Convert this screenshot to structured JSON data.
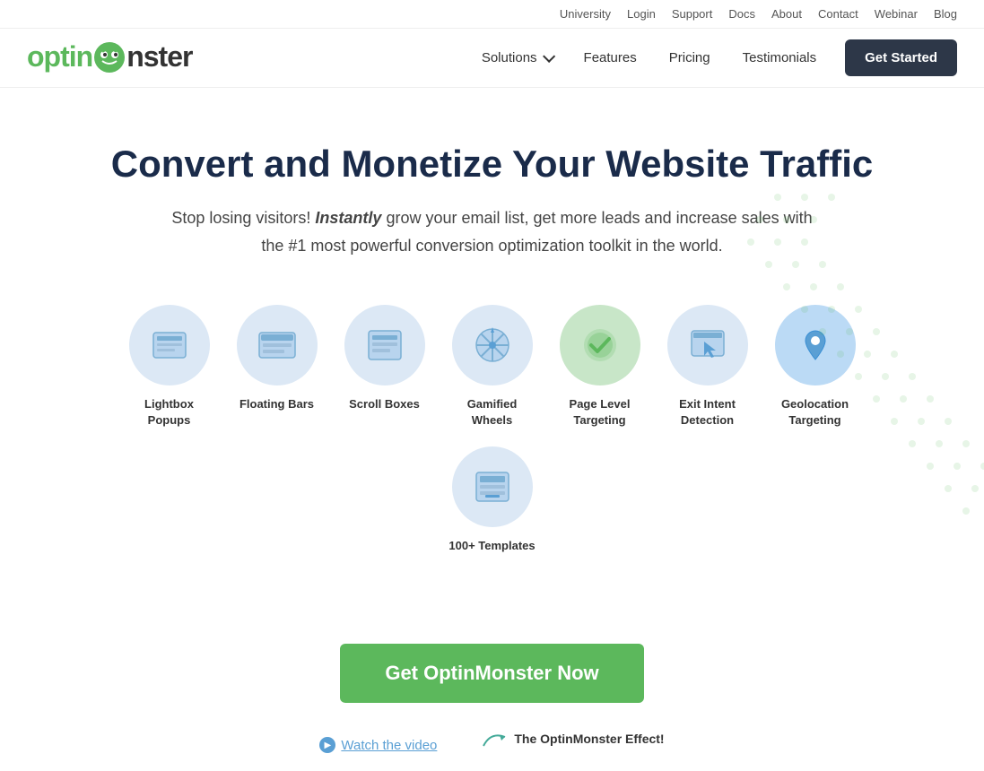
{
  "topNav": {
    "links": [
      {
        "label": "University",
        "name": "university-link"
      },
      {
        "label": "Login",
        "name": "login-link"
      },
      {
        "label": "Support",
        "name": "support-link"
      },
      {
        "label": "Docs",
        "name": "docs-link"
      },
      {
        "label": "About",
        "name": "about-link"
      },
      {
        "label": "Contact",
        "name": "contact-link"
      },
      {
        "label": "Webinar",
        "name": "webinar-link"
      },
      {
        "label": "Blog",
        "name": "blog-link"
      }
    ]
  },
  "mainNav": {
    "logo": {
      "optin": "optin",
      "onster": "nster"
    },
    "links": [
      {
        "label": "Solutions",
        "name": "solutions-nav",
        "hasDropdown": true
      },
      {
        "label": "Features",
        "name": "features-nav"
      },
      {
        "label": "Pricing",
        "name": "pricing-nav"
      },
      {
        "label": "Testimonials",
        "name": "testimonials-nav"
      }
    ],
    "cta": "Get Started"
  },
  "hero": {
    "heading": "Convert and Monetize Your Website Traffic",
    "subtext_before": "Stop losing visitors! ",
    "subtext_italic": "Instantly",
    "subtext_after": " grow your email list, get more leads and increase sales with the #1 most powerful conversion optimization toolkit in the world.",
    "features": [
      {
        "label": "Lightbox Popups",
        "name": "lightbox-feature",
        "icon": "lightbox"
      },
      {
        "label": "Floating Bars",
        "name": "floating-bars-feature",
        "icon": "floating"
      },
      {
        "label": "Scroll Boxes",
        "name": "scroll-boxes-feature",
        "icon": "scroll"
      },
      {
        "label": "Gamified Wheels",
        "name": "gamified-wheels-feature",
        "icon": "wheel"
      },
      {
        "label": "Page Level Targeting",
        "name": "page-level-feature",
        "icon": "check"
      },
      {
        "label": "Exit Intent Detection",
        "name": "exit-intent-feature",
        "icon": "exit"
      },
      {
        "label": "Geolocation Targeting",
        "name": "geolocation-feature",
        "icon": "geo"
      },
      {
        "label": "100+ Templates",
        "name": "templates-feature",
        "icon": "templates"
      }
    ],
    "cta_button": "Get OptinMonster Now",
    "watch_video": "Watch the video",
    "effect_text": "The OptinMonster Effect!"
  },
  "colors": {
    "accent_green": "#5cb85c",
    "dark_nav": "#2d3748",
    "text_dark": "#1a2b4a",
    "circle_bg": "#dce8f5",
    "icon_blue": "#5a9fd4"
  }
}
